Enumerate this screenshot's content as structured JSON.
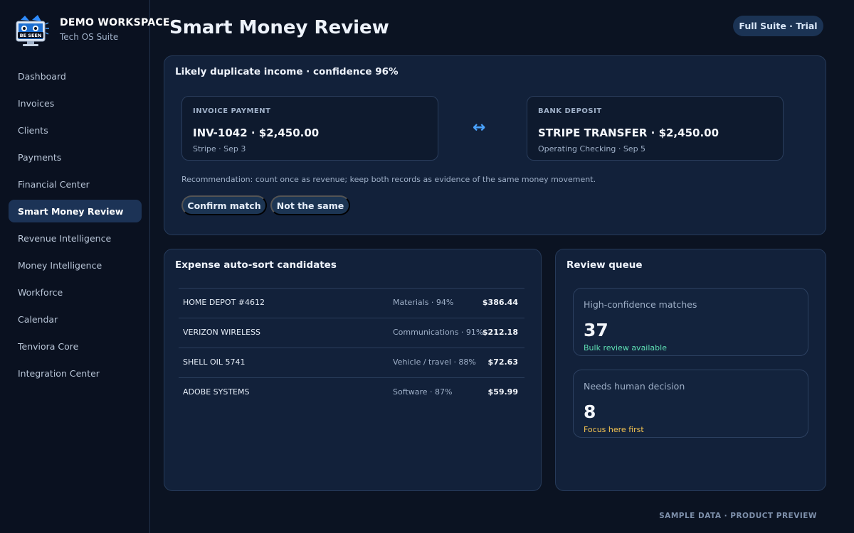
{
  "brand": {
    "name": "DEMO WORKSPACE",
    "subtitle": "Tech OS Suite",
    "logo_text": "BE SEEN"
  },
  "nav": {
    "items": [
      {
        "label": "Dashboard",
        "active": false
      },
      {
        "label": "Invoices",
        "active": false
      },
      {
        "label": "Clients",
        "active": false
      },
      {
        "label": "Payments",
        "active": false
      },
      {
        "label": "Financial Center",
        "active": false
      },
      {
        "label": "Smart Money Review",
        "active": true
      },
      {
        "label": "Revenue Intelligence",
        "active": false
      },
      {
        "label": "Money Intelligence",
        "active": false
      },
      {
        "label": "Workforce",
        "active": false
      },
      {
        "label": "Calendar",
        "active": false
      },
      {
        "label": "Tenviora Core",
        "active": false
      },
      {
        "label": "Integration Center",
        "active": false
      }
    ]
  },
  "header": {
    "title": "Smart Money Review",
    "plan_badge": "Full Suite · Trial"
  },
  "duplicate": {
    "title": "Likely duplicate income · confidence 96%",
    "left": {
      "kind": "INVOICE PAYMENT",
      "main": "INV-1042 · $2,450.00",
      "meta": "Stripe · Sep 3"
    },
    "link_icon": "↔",
    "right": {
      "kind": "BANK DEPOSIT",
      "main": "STRIPE TRANSFER · $2,450.00",
      "meta": "Operating Checking · Sep 5"
    },
    "recommendation": "Recommendation: count once as revenue; keep both records as evidence of the same money movement.",
    "confirm_label": "Confirm match",
    "reject_label": "Not the same"
  },
  "expenses": {
    "title": "Expense auto-sort candidates",
    "rows": [
      {
        "merchant": "HOME DEPOT #4612",
        "category": "Materials · 94%",
        "amount": "$386.44"
      },
      {
        "merchant": "VERIZON WIRELESS",
        "category": "Communications · 91%",
        "amount": "$212.18"
      },
      {
        "merchant": "SHELL OIL 5741",
        "category": "Vehicle / travel · 88%",
        "amount": "$72.63"
      },
      {
        "merchant": "ADOBE SYSTEMS",
        "category": "Software · 87%",
        "amount": "$59.99"
      }
    ]
  },
  "queue": {
    "title": "Review queue",
    "stats": [
      {
        "label": "High-confidence matches",
        "value": "37",
        "note": "Bulk review available",
        "note_color": "#5fe0b4"
      },
      {
        "label": "Needs human decision",
        "value": "8",
        "note": "Focus here first",
        "note_color": "#f5c451"
      }
    ]
  },
  "footer": "SAMPLE DATA · PRODUCT PREVIEW",
  "colors": {
    "accent": "#4aa3ff",
    "active_nav": "#1c3356",
    "background": "#0b1322"
  }
}
